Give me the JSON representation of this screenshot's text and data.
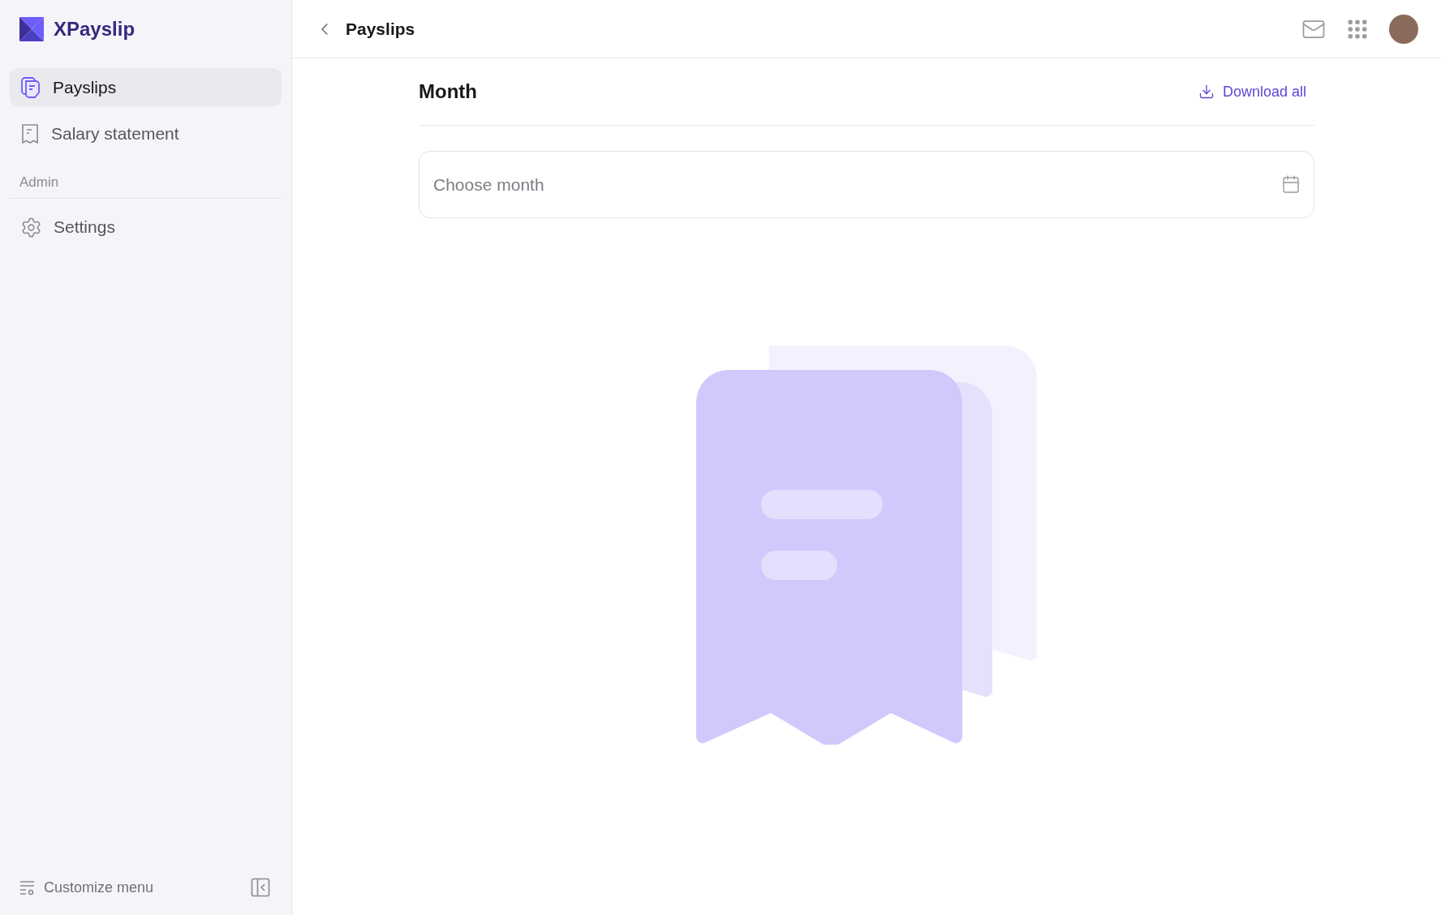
{
  "sidebar": {
    "brand": "XPayslip",
    "items": [
      {
        "label": "Payslips",
        "kind": "payslips",
        "selected": true
      },
      {
        "label": "Salary statement",
        "kind": "statement",
        "selected": false
      }
    ],
    "sections": [
      {
        "title": "Admin",
        "items": [
          {
            "label": "Settings",
            "kind": "settings",
            "selected": false
          }
        ]
      }
    ],
    "footer": {
      "customize": "Customize menu"
    }
  },
  "topbar": {
    "title": "Payslips"
  },
  "content": {
    "heading": "Month",
    "download": "Download all",
    "month_field": {
      "placeholder": "Choose month"
    }
  }
}
